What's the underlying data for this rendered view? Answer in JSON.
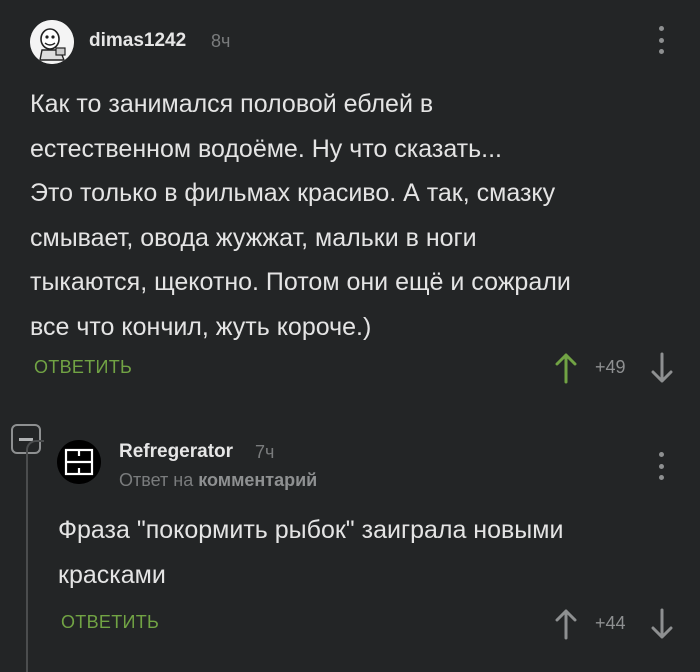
{
  "comment": {
    "author": "dimas1242",
    "time": "8ч",
    "text": "Как то занимался половой еблей в\nестественном водоёме. Ну что сказать...\nЭто только в фильмах красиво. А так, смазку\nсмывает, овода жужжат, мальки в ноги\nтыкаются, щекотно. Потом они ещё и сожрали\nвсе что кончил, жуть короче.)",
    "reply_label": "ОТВЕТИТЬ",
    "rating": "+49",
    "avatar_icon": "meme-face-avatar-icon",
    "upvote_color": "#71a344"
  },
  "reply": {
    "author": "Refregerator",
    "time": "7ч",
    "reply_prefix": "Ответ на",
    "reply_target": "комментарий",
    "text": "Фраза \"покормить рыбок\" заиграла новыми\nкрасками",
    "reply_label": "ОТВЕТИТЬ",
    "rating": "+44",
    "avatar_icon": "rammstein-logo-avatar-icon"
  },
  "colors": {
    "background": "#232526",
    "accent_green": "#71a344",
    "muted": "#8e9091"
  }
}
